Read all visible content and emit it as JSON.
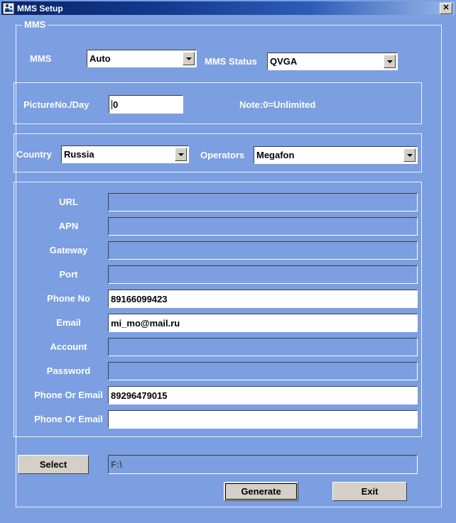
{
  "window": {
    "title": "MMS Setup",
    "icon": "app-icon",
    "close_label": "✕"
  },
  "group": {
    "mms_legend": "MMS"
  },
  "top_row": {
    "mms_label": "MMS",
    "mms_value": "Auto",
    "mms_status_label": "MMS Status",
    "mms_status_value": "QVGA"
  },
  "picture_section": {
    "label": "PictureNo./Day",
    "value": "0",
    "note": "Note:0=Unlimited"
  },
  "region_section": {
    "country_label": "Country",
    "country_value": "Russia",
    "operators_label": "Operators",
    "operators_value": "Megafon"
  },
  "fields": [
    {
      "label": "URL",
      "value": "",
      "disabled": true
    },
    {
      "label": "APN",
      "value": "",
      "disabled": true
    },
    {
      "label": "Gateway",
      "value": "",
      "disabled": true
    },
    {
      "label": "Port",
      "value": "",
      "disabled": true
    },
    {
      "label": "Phone No",
      "value": "89166099423",
      "disabled": false
    },
    {
      "label": "Email",
      "value": "mi_mo@mail.ru",
      "disabled": false
    },
    {
      "label": "Account",
      "value": "",
      "disabled": true
    },
    {
      "label": "Password",
      "value": "",
      "disabled": true
    },
    {
      "label": "Phone Or Email",
      "value": "89296479015",
      "disabled": false
    },
    {
      "label": "Phone Or Email",
      "value": "",
      "disabled": false
    }
  ],
  "footer": {
    "select_label": "Select",
    "path_value": "F:\\",
    "generate_label": "Generate",
    "exit_label": "Exit"
  },
  "colors": {
    "form_background": "#7b9fe0",
    "title_start": "#0a246a",
    "title_end": "#98b8e8",
    "button_face": "#d4d0c8",
    "label_text": "#ffffff",
    "input_text": "#000000",
    "disabled_text": "#4a4a4a"
  }
}
